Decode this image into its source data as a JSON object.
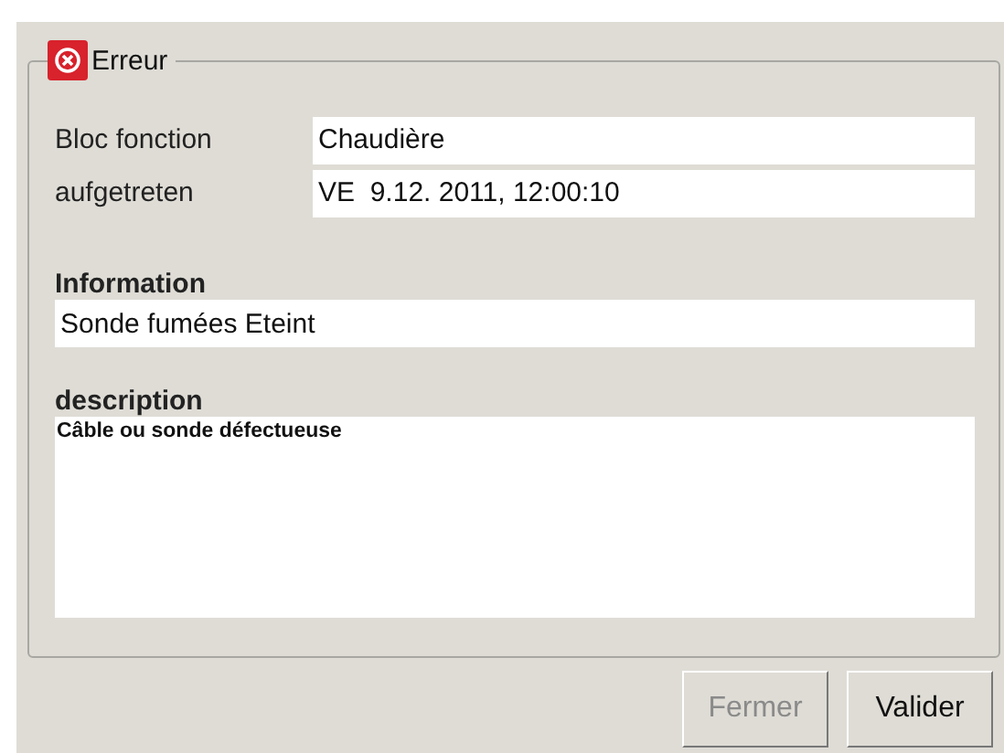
{
  "group": {
    "title": "Erreur"
  },
  "fields": [
    {
      "label": "Bloc fonction",
      "value": "Chaudière"
    },
    {
      "label": "aufgetreten",
      "value": "VE  9.12. 2011, 12:00:10"
    }
  ],
  "information": {
    "label": "Information",
    "value": "Sonde fumées Eteint"
  },
  "description": {
    "label": "description",
    "value": "Câble ou sonde défectueuse"
  },
  "buttons": [
    {
      "label": "Fermer",
      "disabled": true
    },
    {
      "label": "Valider",
      "disabled": false
    }
  ]
}
